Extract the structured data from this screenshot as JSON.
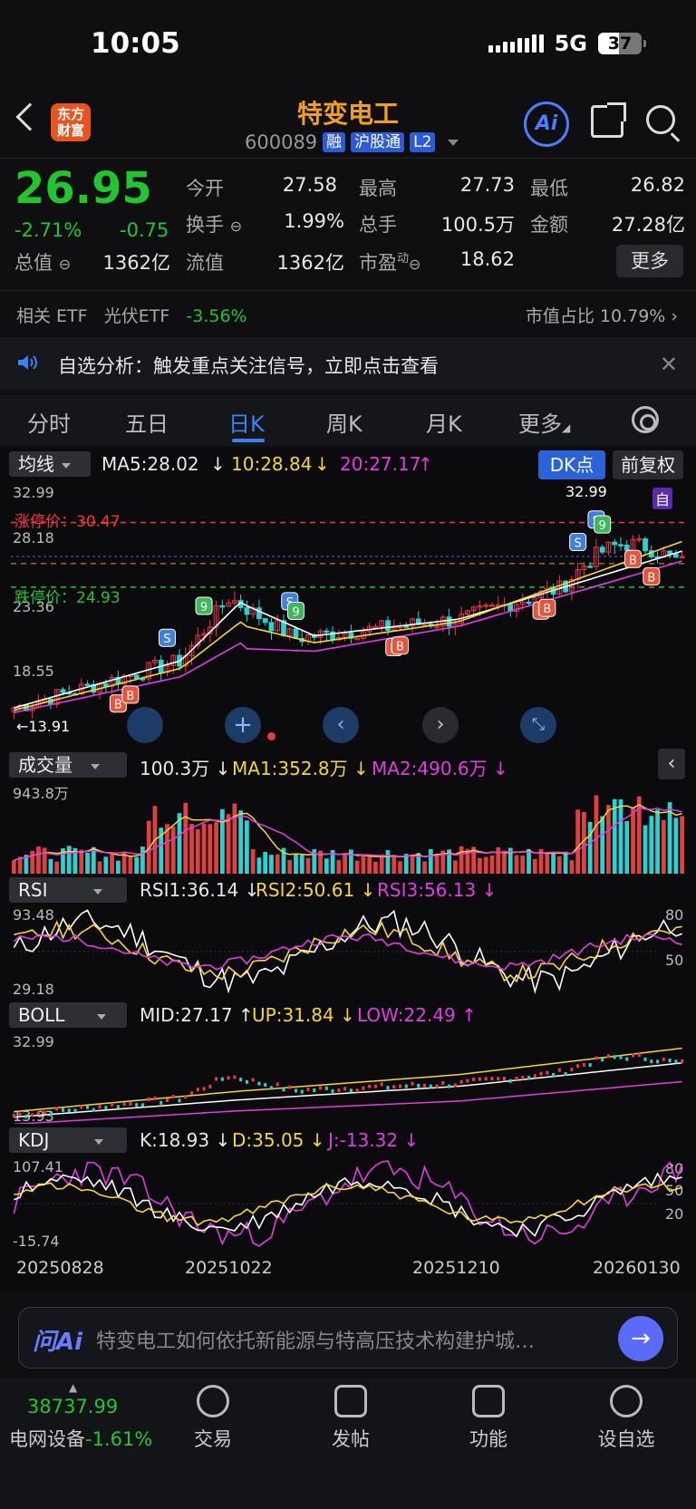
{
  "status": {
    "time": "10:05",
    "network": "5G",
    "battery": "37"
  },
  "header": {
    "logo": "东方\n财富",
    "title": "特变电工",
    "code": "600089",
    "tags": [
      "融",
      "沪股通",
      "L2"
    ],
    "ai_label": "Ai"
  },
  "quote": {
    "price": "26.95",
    "change_pct": "-2.71%",
    "change": "-0.75",
    "open_label": "今开",
    "open": "27.58",
    "high_label": "最高",
    "high": "27.73",
    "low_label": "最低",
    "low": "26.82",
    "turnover_label": "换手",
    "turnover": "1.99%",
    "volume_label": "总手",
    "volume": "100.5万",
    "amount_label": "金额",
    "amount": "27.28亿",
    "mktcap_label": "总值",
    "mktcap": "1362亿",
    "float_label": "流值",
    "float": "1362亿",
    "pe_label": "市盈",
    "pe_sup": "动",
    "pe": "18.62",
    "more": "更多"
  },
  "etf": {
    "label": "相关 ETF",
    "name": "光伏ETF",
    "change": "-3.56%",
    "right": "市值占比 10.79%"
  },
  "notice": {
    "text": "自选分析：触发重点关注信号，立即点击查看"
  },
  "tabs": [
    "分时",
    "五日",
    "日K",
    "周K",
    "月K",
    "更多"
  ],
  "active_tab": "日K",
  "main_chart": {
    "selector": "均线",
    "ma5": "MA5:28.02",
    "ma10": "10:28.84",
    "ma20": "20:27.17",
    "dk": "DK点",
    "fq": "前复权",
    "y_labels": [
      "32.99",
      "28.18",
      "23.36",
      "18.55"
    ],
    "limit_up": "涨停价：30.47",
    "limit_down": "跌停价：24.93",
    "high_mark": "32.99",
    "low_mark": "13.91",
    "custom_tag": "自"
  },
  "volume_chart": {
    "selector": "成交量",
    "value": "100.3万",
    "ma1": "MA1:352.8万",
    "ma2": "MA2:490.6万",
    "ymax": "943.8万"
  },
  "rsi_chart": {
    "selector": "RSI",
    "rsi1": "RSI1:36.14",
    "rsi2": "RSI2:50.61",
    "rsi3": "RSI3:56.13",
    "ymax": "93.48",
    "ymin": "29.18",
    "r80": "80",
    "r50": "50"
  },
  "boll_chart": {
    "selector": "BOLL",
    "mid": "MID:27.17",
    "up": "UP:31.84",
    "low": "LOW:22.49",
    "ymax": "32.99",
    "ymin": "13.93"
  },
  "kdj_chart": {
    "selector": "KDJ",
    "k": "K:18.93",
    "d": "D:35.05",
    "j": "J:-13.32",
    "ymax": "107.41",
    "ymin": "-15.74",
    "r80": "80",
    "r50": "50",
    "r20": "20"
  },
  "dates": [
    "20250828",
    "20251022",
    "20251210",
    "20260130"
  ],
  "ai_prompt": {
    "label": "问Ai",
    "text": "特变电工如何依托新能源与特高压技术构建护城…"
  },
  "bottom_nav": {
    "index_value": "38737.99",
    "index_name": "电网设备",
    "index_change": "-1.61%",
    "items": [
      "交易",
      "发帖",
      "功能",
      "设自选"
    ]
  },
  "colors": {
    "up": "#f23645",
    "down": "#21c62e",
    "accent": "#3b82f6",
    "ma10": "#f5d630",
    "ma20": "#e23be2",
    "brand": "#f0a01e"
  },
  "chart_data": {
    "type": "line",
    "title": "",
    "ylim": [
      13.91,
      32.99
    ],
    "x": [
      "20250828",
      "20251022",
      "20251210",
      "20260130"
    ],
    "series": [
      {
        "name": "MA5",
        "values": [
          14.6,
          20.0,
          22.2,
          28.02
        ]
      },
      {
        "name": "10",
        "values": [
          14.4,
          19.2,
          22.0,
          28.84
        ]
      },
      {
        "name": "20",
        "values": [
          14.2,
          18.3,
          21.6,
          27.17
        ]
      }
    ]
  }
}
